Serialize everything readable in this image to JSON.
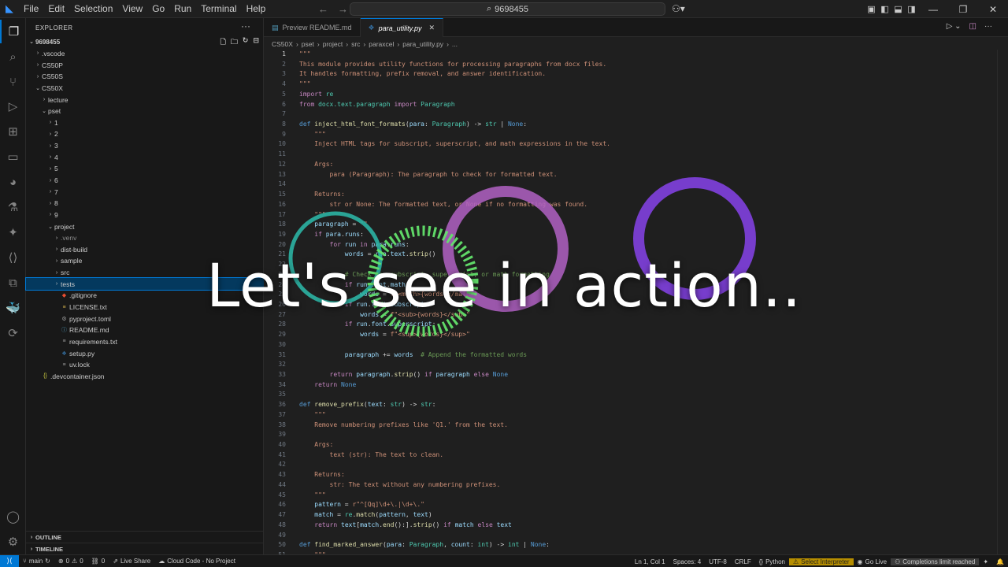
{
  "menu": [
    "File",
    "Edit",
    "Selection",
    "View",
    "Go",
    "Run",
    "Terminal",
    "Help"
  ],
  "search": {
    "text": "9698455"
  },
  "explorer": {
    "title": "EXPLORER",
    "root": "9698455",
    "items": [
      {
        "label": ".vscode",
        "depth": 1,
        "type": "folder",
        "open": false
      },
      {
        "label": "CS50P",
        "depth": 1,
        "type": "folder",
        "open": false
      },
      {
        "label": "CS50S",
        "depth": 1,
        "type": "folder",
        "open": false
      },
      {
        "label": "CS50X",
        "depth": 1,
        "type": "folder",
        "open": true
      },
      {
        "label": "lecture",
        "depth": 2,
        "type": "folder",
        "open": false
      },
      {
        "label": "pset",
        "depth": 2,
        "type": "folder",
        "open": true
      },
      {
        "label": "1",
        "depth": 3,
        "type": "folder",
        "open": false
      },
      {
        "label": "2",
        "depth": 3,
        "type": "folder",
        "open": false
      },
      {
        "label": "3",
        "depth": 3,
        "type": "folder",
        "open": false
      },
      {
        "label": "4",
        "depth": 3,
        "type": "folder",
        "open": false
      },
      {
        "label": "5",
        "depth": 3,
        "type": "folder",
        "open": false
      },
      {
        "label": "6",
        "depth": 3,
        "type": "folder",
        "open": false
      },
      {
        "label": "7",
        "depth": 3,
        "type": "folder",
        "open": false
      },
      {
        "label": "8",
        "depth": 3,
        "type": "folder",
        "open": false
      },
      {
        "label": "9",
        "depth": 3,
        "type": "folder",
        "open": false
      },
      {
        "label": "project",
        "depth": 3,
        "type": "folder",
        "open": true
      },
      {
        "label": ".venv",
        "depth": 4,
        "type": "folder",
        "open": false,
        "dim": true
      },
      {
        "label": "dist-build",
        "depth": 4,
        "type": "folder",
        "open": false
      },
      {
        "label": "sample",
        "depth": 4,
        "type": "folder",
        "open": false
      },
      {
        "label": "src",
        "depth": 4,
        "type": "folder",
        "open": false
      },
      {
        "label": "tests",
        "depth": 4,
        "type": "folder",
        "open": false,
        "selected": true
      },
      {
        "label": ".gitignore",
        "depth": 4,
        "type": "file",
        "icon": "git-icon"
      },
      {
        "label": "LICENSE.txt",
        "depth": 4,
        "type": "file",
        "icon": "license-icon"
      },
      {
        "label": "pyproject.toml",
        "depth": 4,
        "type": "file",
        "icon": "toml-icon"
      },
      {
        "label": "README.md",
        "depth": 4,
        "type": "file",
        "icon": "info-icon"
      },
      {
        "label": "requirements.txt",
        "depth": 4,
        "type": "file",
        "icon": "text-file-icon"
      },
      {
        "label": "setup.py",
        "depth": 4,
        "type": "file",
        "icon": "python-icon"
      },
      {
        "label": "uv.lock",
        "depth": 4,
        "type": "file",
        "icon": "text-file-icon"
      },
      {
        "label": ".devcontainer.json",
        "depth": 1,
        "type": "file",
        "icon": "json-icon"
      }
    ],
    "outline": "OUTLINE",
    "timeline": "TIMELINE"
  },
  "tabs": [
    {
      "label": "Preview README.md",
      "active": false
    },
    {
      "label": "para_utility.py",
      "active": true
    }
  ],
  "breadcrumbs": [
    "CS50X",
    "pset",
    "project",
    "src",
    "paraxcel",
    "para_utility.py",
    "..."
  ],
  "code": [
    [
      [
        "s",
        "\"\"\""
      ]
    ],
    [
      [
        "s",
        "This module provides utility functions for processing paragraphs from docx files."
      ]
    ],
    [
      [
        "s",
        "It handles formatting, prefix removal, and answer identification."
      ]
    ],
    [
      [
        "s",
        "\"\"\""
      ]
    ],
    [
      [
        "kc",
        "import"
      ],
      [
        "p",
        " "
      ],
      [
        "t",
        "re"
      ]
    ],
    [
      [
        "kc",
        "from"
      ],
      [
        "p",
        " "
      ],
      [
        "t",
        "docx.text.paragraph"
      ],
      [
        "p",
        " "
      ],
      [
        "kc",
        "import"
      ],
      [
        "p",
        " "
      ],
      [
        "t",
        "Paragraph"
      ]
    ],
    [],
    [
      [
        "k",
        "def"
      ],
      [
        "p",
        " "
      ],
      [
        "f",
        "inject_html_font_formats"
      ],
      [
        "p",
        "("
      ],
      [
        "v",
        "para"
      ],
      [
        "p",
        ": "
      ],
      [
        "t",
        "Paragraph"
      ],
      [
        "p",
        ") -> "
      ],
      [
        "t",
        "str"
      ],
      [
        "p",
        " | "
      ],
      [
        "k",
        "None"
      ],
      [
        "p",
        ":"
      ]
    ],
    [
      [
        "p",
        "    "
      ],
      [
        "s",
        "\"\"\""
      ]
    ],
    [
      [
        "s",
        "    Inject HTML tags for subscript, superscript, and math expressions in the text."
      ]
    ],
    [],
    [
      [
        "s",
        "    Args:"
      ]
    ],
    [
      [
        "s",
        "        para (Paragraph): The paragraph to check for formatted text."
      ]
    ],
    [],
    [
      [
        "s",
        "    Returns:"
      ]
    ],
    [
      [
        "s",
        "        str or None: The formatted text, or None if no formatting was found."
      ]
    ],
    [
      [
        "s",
        "    \"\"\""
      ]
    ],
    [
      [
        "p",
        "    "
      ],
      [
        "v",
        "paragraph"
      ],
      [
        "p",
        " = "
      ],
      [
        "s",
        "\"\""
      ]
    ],
    [
      [
        "p",
        "    "
      ],
      [
        "kc",
        "if"
      ],
      [
        "p",
        " "
      ],
      [
        "v",
        "para"
      ],
      [
        "p",
        "."
      ],
      [
        "v",
        "runs"
      ],
      [
        "p",
        ":"
      ]
    ],
    [
      [
        "p",
        "        "
      ],
      [
        "kc",
        "for"
      ],
      [
        "p",
        " "
      ],
      [
        "v",
        "run"
      ],
      [
        "p",
        " "
      ],
      [
        "kc",
        "in"
      ],
      [
        "p",
        " "
      ],
      [
        "v",
        "para"
      ],
      [
        "p",
        "."
      ],
      [
        "v",
        "runs"
      ],
      [
        "p",
        ":"
      ]
    ],
    [
      [
        "p",
        "            "
      ],
      [
        "v",
        "words"
      ],
      [
        "p",
        " = "
      ],
      [
        "v",
        "run"
      ],
      [
        "p",
        "."
      ],
      [
        "v",
        "text"
      ],
      [
        "p",
        "."
      ],
      [
        "f",
        "strip"
      ],
      [
        "p",
        "()"
      ]
    ],
    [],
    [
      [
        "c",
        "            # Check for subscript, superscript, or math formatting"
      ]
    ],
    [
      [
        "p",
        "            "
      ],
      [
        "kc",
        "if"
      ],
      [
        "p",
        " "
      ],
      [
        "v",
        "run"
      ],
      [
        "p",
        "."
      ],
      [
        "v",
        "font"
      ],
      [
        "p",
        "."
      ],
      [
        "v",
        "math"
      ],
      [
        "p",
        ":"
      ]
    ],
    [
      [
        "p",
        "                "
      ],
      [
        "v",
        "words"
      ],
      [
        "p",
        " = "
      ],
      [
        "s",
        "f\"<math>{words}</math>\""
      ]
    ],
    [
      [
        "p",
        "            "
      ],
      [
        "kc",
        "if"
      ],
      [
        "p",
        " "
      ],
      [
        "v",
        "run"
      ],
      [
        "p",
        "."
      ],
      [
        "v",
        "font"
      ],
      [
        "p",
        "."
      ],
      [
        "v",
        "subscript"
      ],
      [
        "p",
        ":"
      ]
    ],
    [
      [
        "p",
        "                "
      ],
      [
        "v",
        "words"
      ],
      [
        "p",
        " = "
      ],
      [
        "s",
        "f\"<sub>{words}</sub>\""
      ]
    ],
    [
      [
        "p",
        "            "
      ],
      [
        "kc",
        "if"
      ],
      [
        "p",
        " "
      ],
      [
        "v",
        "run"
      ],
      [
        "p",
        "."
      ],
      [
        "v",
        "font"
      ],
      [
        "p",
        "."
      ],
      [
        "v",
        "superscript"
      ],
      [
        "p",
        ":"
      ]
    ],
    [
      [
        "p",
        "                "
      ],
      [
        "v",
        "words"
      ],
      [
        "p",
        " = "
      ],
      [
        "s",
        "f\"<sup>{words}</sup>\""
      ]
    ],
    [],
    [
      [
        "p",
        "            "
      ],
      [
        "v",
        "paragraph"
      ],
      [
        "p",
        " += "
      ],
      [
        "v",
        "words"
      ],
      [
        "p",
        "  "
      ],
      [
        "c",
        "# Append the formatted words"
      ]
    ],
    [],
    [
      [
        "p",
        "        "
      ],
      [
        "kc",
        "return"
      ],
      [
        "p",
        " "
      ],
      [
        "v",
        "paragraph"
      ],
      [
        "p",
        "."
      ],
      [
        "f",
        "strip"
      ],
      [
        "p",
        "() "
      ],
      [
        "kc",
        "if"
      ],
      [
        "p",
        " "
      ],
      [
        "v",
        "paragraph"
      ],
      [
        "p",
        " "
      ],
      [
        "kc",
        "else"
      ],
      [
        "p",
        " "
      ],
      [
        "k",
        "None"
      ]
    ],
    [
      [
        "p",
        "    "
      ],
      [
        "kc",
        "return"
      ],
      [
        "p",
        " "
      ],
      [
        "k",
        "None"
      ]
    ],
    [],
    [
      [
        "k",
        "def"
      ],
      [
        "p",
        " "
      ],
      [
        "f",
        "remove_prefix"
      ],
      [
        "p",
        "("
      ],
      [
        "v",
        "text"
      ],
      [
        "p",
        ": "
      ],
      [
        "t",
        "str"
      ],
      [
        "p",
        ") -> "
      ],
      [
        "t",
        "str"
      ],
      [
        "p",
        ":"
      ]
    ],
    [
      [
        "s",
        "    \"\"\""
      ]
    ],
    [
      [
        "s",
        "    Remove numbering prefixes like 'Q1.' from the text."
      ]
    ],
    [],
    [
      [
        "s",
        "    Args:"
      ]
    ],
    [
      [
        "s",
        "        text (str): The text to clean."
      ]
    ],
    [],
    [
      [
        "s",
        "    Returns:"
      ]
    ],
    [
      [
        "s",
        "        str: The text without any numbering prefixes."
      ]
    ],
    [
      [
        "s",
        "    \"\"\""
      ]
    ],
    [
      [
        "p",
        "    "
      ],
      [
        "v",
        "pattern"
      ],
      [
        "p",
        " = "
      ],
      [
        "s",
        "r\"^[Qq]\\d+\\.|\\d+\\.\""
      ]
    ],
    [
      [
        "p",
        "    "
      ],
      [
        "v",
        "match"
      ],
      [
        "p",
        " = "
      ],
      [
        "t",
        "re"
      ],
      [
        "p",
        "."
      ],
      [
        "f",
        "match"
      ],
      [
        "p",
        "("
      ],
      [
        "v",
        "pattern"
      ],
      [
        "p",
        ", "
      ],
      [
        "v",
        "text"
      ],
      [
        "p",
        ")"
      ]
    ],
    [
      [
        "p",
        "    "
      ],
      [
        "kc",
        "return"
      ],
      [
        "p",
        " "
      ],
      [
        "v",
        "text"
      ],
      [
        "p",
        "["
      ],
      [
        "v",
        "match"
      ],
      [
        "p",
        "."
      ],
      [
        "f",
        "end"
      ],
      [
        "p",
        "():]."
      ],
      [
        "f",
        "strip"
      ],
      [
        "p",
        "() "
      ],
      [
        "kc",
        "if"
      ],
      [
        "p",
        " "
      ],
      [
        "v",
        "match"
      ],
      [
        "p",
        " "
      ],
      [
        "kc",
        "else"
      ],
      [
        "p",
        " "
      ],
      [
        "v",
        "text"
      ]
    ],
    [],
    [
      [
        "k",
        "def"
      ],
      [
        "p",
        " "
      ],
      [
        "f",
        "find_marked_answer"
      ],
      [
        "p",
        "("
      ],
      [
        "v",
        "para"
      ],
      [
        "p",
        ": "
      ],
      [
        "t",
        "Paragraph"
      ],
      [
        "p",
        ", "
      ],
      [
        "v",
        "count"
      ],
      [
        "p",
        ": "
      ],
      [
        "t",
        "int"
      ],
      [
        "p",
        ") -> "
      ],
      [
        "t",
        "int"
      ],
      [
        "p",
        " | "
      ],
      [
        "k",
        "None"
      ],
      [
        "p",
        ":"
      ]
    ],
    [
      [
        "s",
        "    \"\"\""
      ]
    ]
  ],
  "overlay": {
    "text": "Let's see in action.."
  },
  "status": {
    "branch": "main",
    "errors": "0",
    "warnings": "0",
    "ports": "0",
    "live_share": "Live Share",
    "cloud_code": "Cloud Code - No Project",
    "position": "Ln 1, Col 1",
    "spaces": "Spaces: 4",
    "encoding": "UTF-8",
    "eol": "CRLF",
    "language": "Python",
    "interpreter": "Select Interpreter",
    "go_live": "Go Live",
    "completions": "Completions limit reached"
  },
  "colors": {
    "accent": "#0078d4",
    "warning": "#b68e00"
  }
}
